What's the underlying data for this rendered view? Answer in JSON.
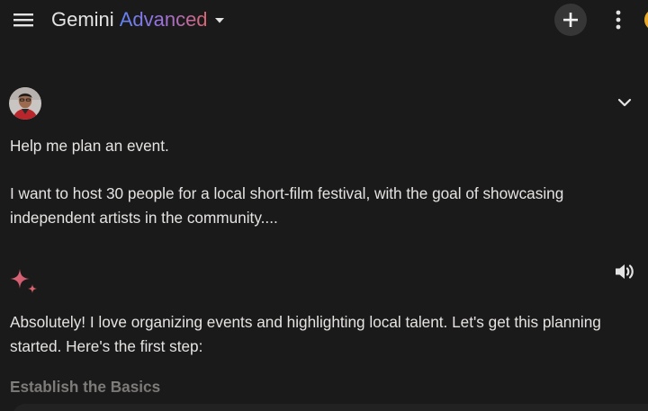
{
  "header": {
    "app_name": "Gemini",
    "tier": "Advanced",
    "icons": {
      "menu": "hamburger-menu-icon",
      "dropdown": "caret-down-icon",
      "new_chat": "plus-icon",
      "more": "more-vert-icon"
    }
  },
  "prompt": {
    "line1": "Help me plan an event.",
    "line2": "I want to host 30 people for a local short-film festival, with the goal of showcasing independent artists in the community...."
  },
  "response": {
    "text": "Absolutely! I love organizing events and highlighting local talent.  Let's get this planning started. Here's the first step:",
    "heading": "Establish the Basics"
  },
  "colors": {
    "background": "#1b1a1a",
    "text": "#e5e4e2",
    "muted": "#8e8c89",
    "gradient_start": "#5f84f2",
    "gradient_end": "#d96570",
    "new_chat_bg": "#363636",
    "account": "#e8a92b"
  }
}
